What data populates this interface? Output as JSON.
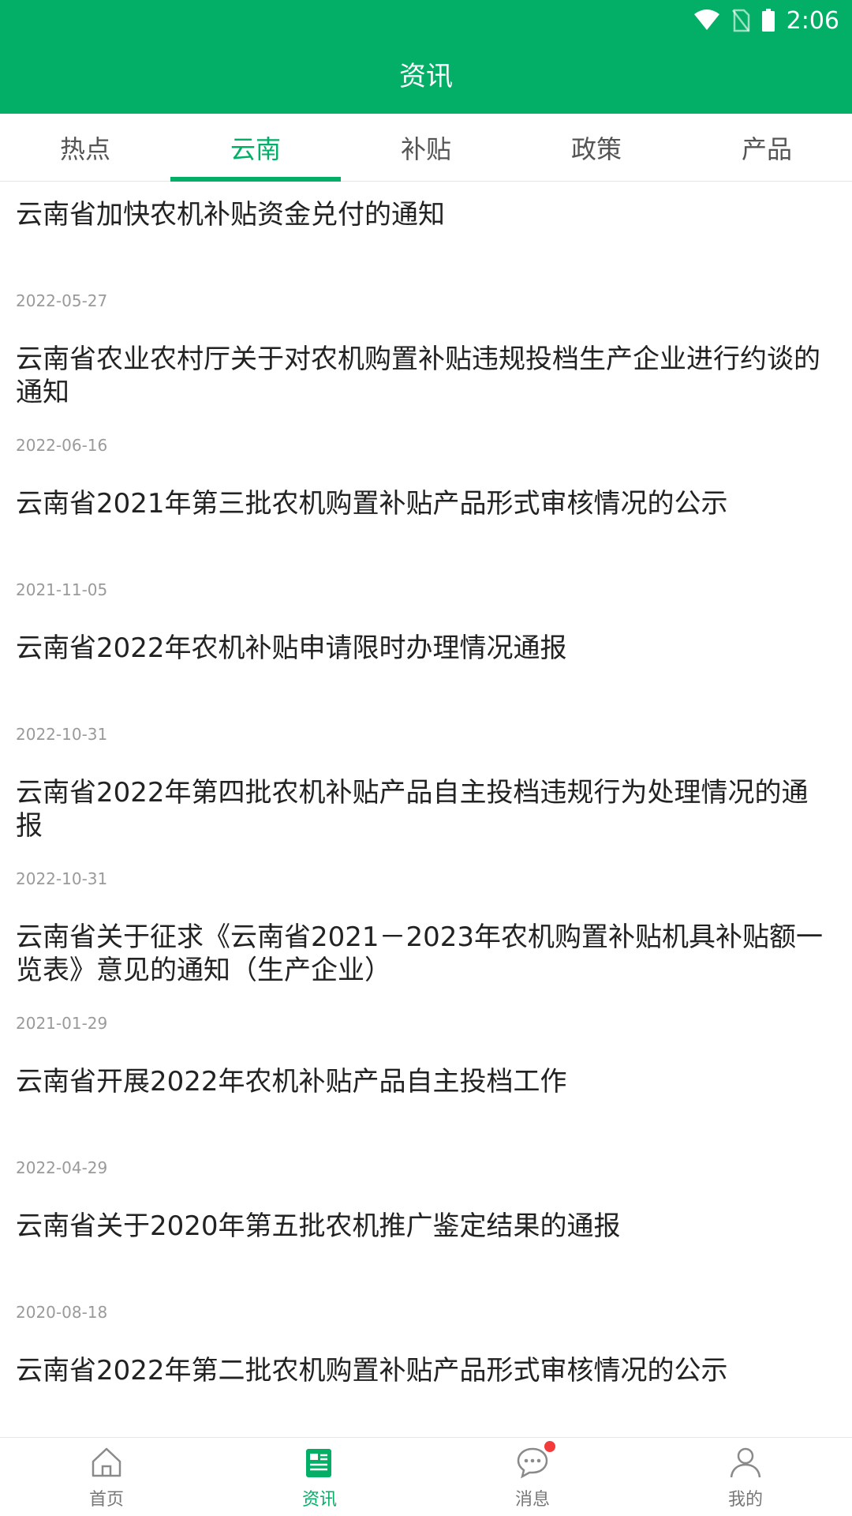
{
  "status_bar": {
    "time": "2:06"
  },
  "header": {
    "title": "资讯"
  },
  "tabs": [
    {
      "label": "热点",
      "active": false
    },
    {
      "label": "云南",
      "active": true
    },
    {
      "label": "补贴",
      "active": false
    },
    {
      "label": "政策",
      "active": false
    },
    {
      "label": "产品",
      "active": false
    }
  ],
  "articles": [
    {
      "title": "云南省加快农机补贴资金兑付的通知",
      "date": "2022-05-27"
    },
    {
      "title": "云南省农业农村厅关于对农机购置补贴违规投档生产企业进行约谈的通知",
      "date": "2022-06-16"
    },
    {
      "title": "云南省2021年第三批农机购置补贴产品形式审核情况的公示",
      "date": "2021-11-05"
    },
    {
      "title": "云南省2022年农机补贴申请限时办理情况通报",
      "date": "2022-10-31"
    },
    {
      "title": "云南省2022年第四批农机补贴产品自主投档违规行为处理情况的通报",
      "date": "2022-10-31"
    },
    {
      "title": "云南省关于征求《云南省2021－2023年农机购置补贴机具补贴额一览表》意见的通知（生产企业）",
      "date": "2021-01-29"
    },
    {
      "title": "云南省开展2022年农机补贴产品自主投档工作",
      "date": "2022-04-29"
    },
    {
      "title": "云南省关于2020年第五批农机推广鉴定结果的通报",
      "date": "2020-08-18"
    },
    {
      "title": "云南省2022年第二批农机购置补贴产品形式审核情况的公示",
      "date": ""
    }
  ],
  "bottom_nav": [
    {
      "label": "首页",
      "icon": "home-icon",
      "active": false
    },
    {
      "label": "资讯",
      "icon": "news-icon",
      "active": true
    },
    {
      "label": "消息",
      "icon": "message-icon",
      "active": false
    },
    {
      "label": "我的",
      "icon": "profile-icon",
      "active": false
    }
  ],
  "colors": {
    "brand": "#03AF66",
    "badge": "#F33B3B"
  }
}
